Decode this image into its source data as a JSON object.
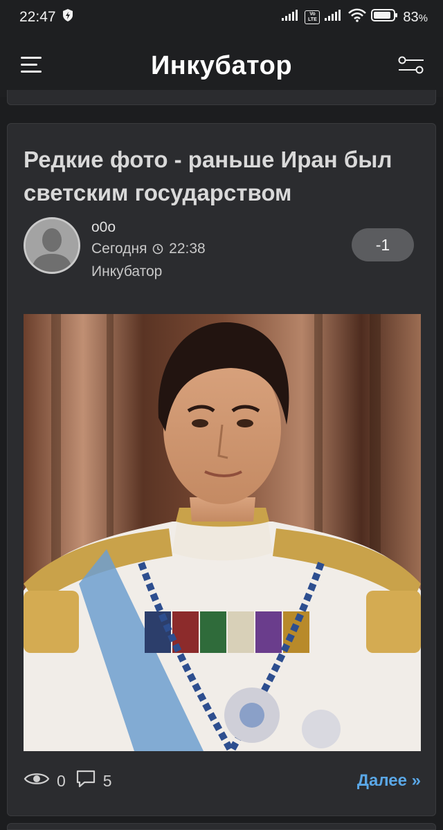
{
  "status_bar": {
    "time": "22:47",
    "battery": "83",
    "battery_unit": "%",
    "network_badge_top": "Vo",
    "network_badge_bottom": "LTE",
    "icons": [
      "shield-bolt-icon",
      "signal-icon",
      "volte-icon",
      "signal-icon",
      "wifi-icon",
      "battery-icon"
    ]
  },
  "app_bar": {
    "title": "Инкубатор",
    "left_icon": "hamburger-menu-icon",
    "right_icon": "filter-sliders-icon"
  },
  "post": {
    "title": "Редкие фото - раньше Иран был светским государством",
    "author": "o0o",
    "date": "Сегодня",
    "time": "22:38",
    "category": "Инкубатор",
    "rating": "-1",
    "views": "0",
    "comments": "5",
    "more_label": "Далее »"
  },
  "colors": {
    "background": "#1c1d1f",
    "card": "#2b2c2f",
    "link": "#5aa7e6",
    "rating_pill": "#5b5c5f"
  }
}
